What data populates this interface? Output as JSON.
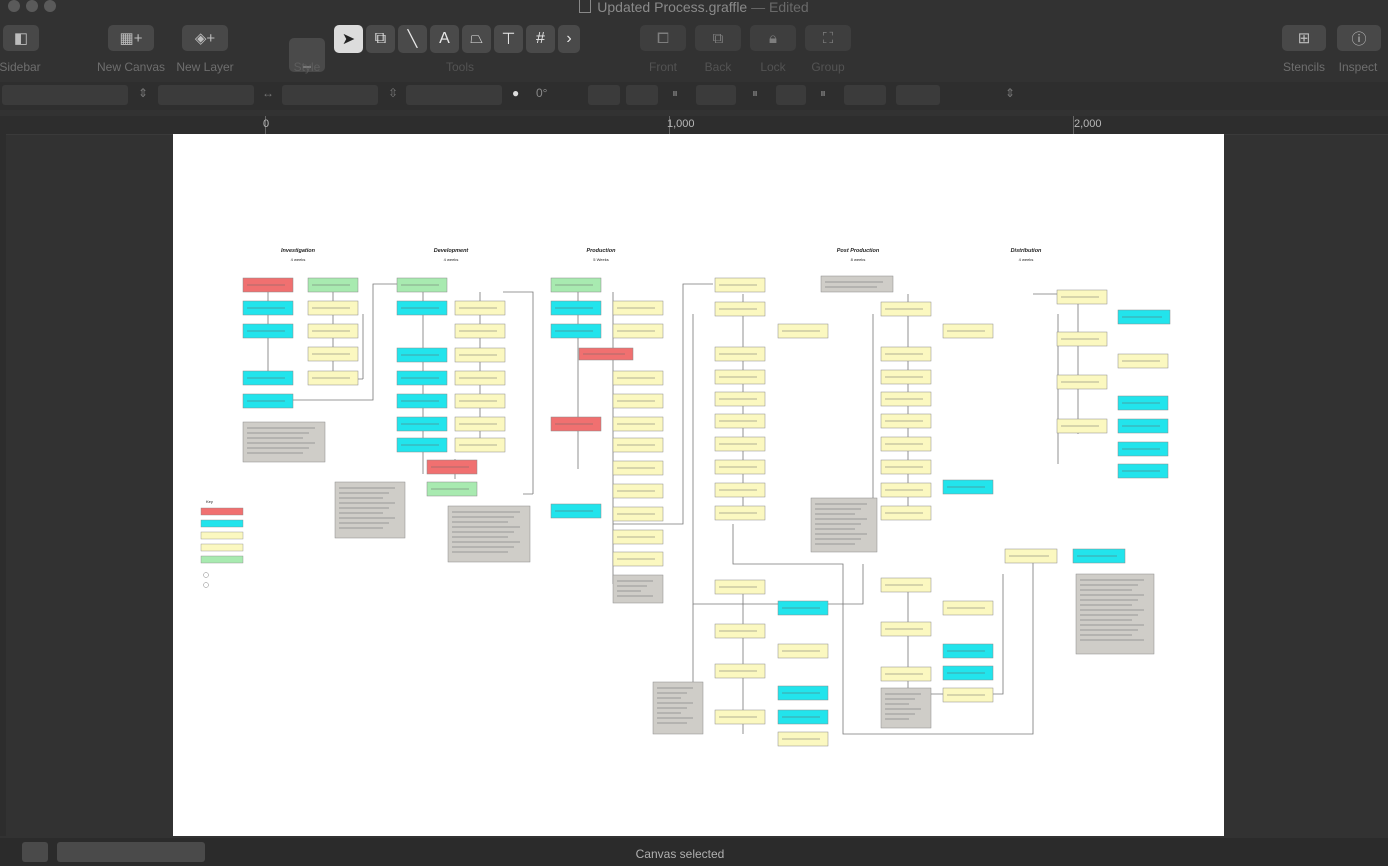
{
  "window": {
    "title": "Updated Process.graffle",
    "status_suffix": "— Edited"
  },
  "toolbar": {
    "sidebar": "Sidebar",
    "new_canvas": "New Canvas",
    "new_layer": "New Layer",
    "style": "Style",
    "tools": "Tools",
    "front": "Front",
    "back": "Back",
    "lock": "Lock",
    "group": "Group",
    "stencils": "Stencils",
    "inspect": "Inspect"
  },
  "inspector": {
    "rotation": "0°"
  },
  "ruler": {
    "marks": [
      "0",
      "1,000",
      "2,000"
    ]
  },
  "diagram": {
    "phases": [
      {
        "name": "Investigation",
        "sub": "4 weeks"
      },
      {
        "name": "Development",
        "sub": "4 weeks"
      },
      {
        "name": "Production",
        "sub": "5 Weeks"
      },
      {
        "name": "Post Production",
        "sub": "8 weeks"
      },
      {
        "name": "Distribution",
        "sub": "4 weeks"
      }
    ],
    "key_title": "Key"
  },
  "colors": {
    "red": "#f07070",
    "cyan": "#22e4ec",
    "yellow": "#fbf8c0",
    "green": "#a8eab0",
    "note": "#cfcdc8"
  },
  "status": {
    "text": "Canvas selected"
  }
}
